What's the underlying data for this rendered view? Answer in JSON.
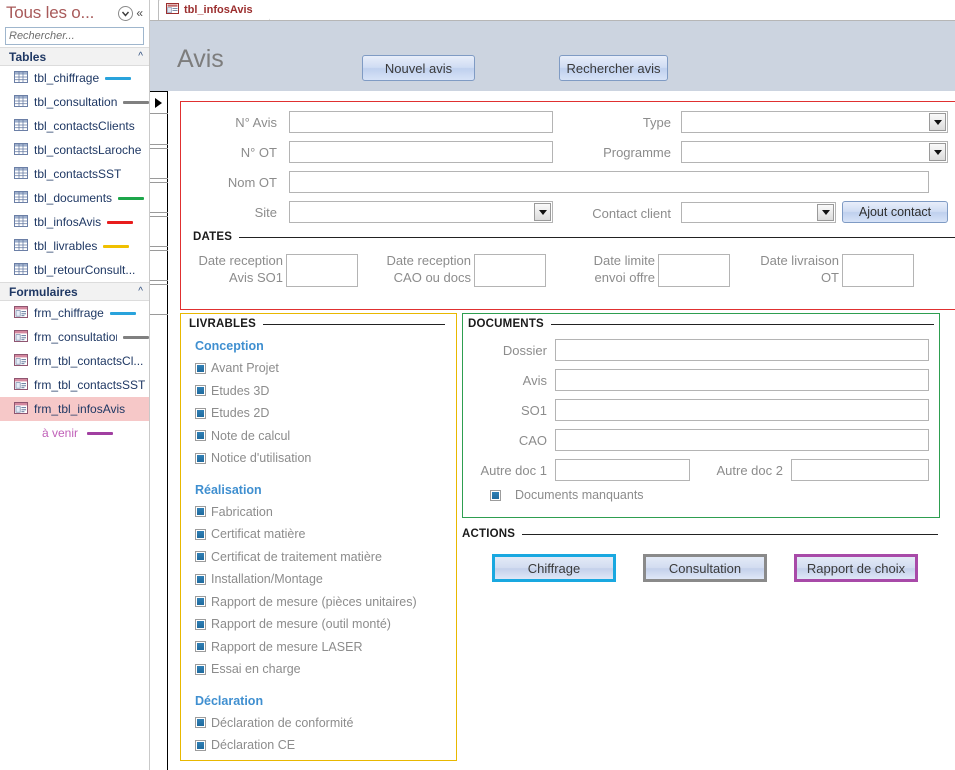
{
  "sidebar": {
    "title": "Tous les o...",
    "dropdown_icon": "chevron-down-circle-icon",
    "collapse_icon": "double-chevron-left-icon",
    "search": {
      "placeholder": "Rechercher...",
      "value": "",
      "icon": "search-icon"
    },
    "groups": [
      {
        "label": "Tables",
        "chevron": "«",
        "items": [
          {
            "label": "tbl_chiffrage",
            "icon": "table-icon",
            "tag_color": "#29a3dc",
            "selected": false
          },
          {
            "label": "tbl_consultation",
            "icon": "table-icon",
            "tag_color": "#808080",
            "selected": false
          },
          {
            "label": "tbl_contactsClients",
            "icon": "table-icon",
            "tag_color": "",
            "selected": false
          },
          {
            "label": "tbl_contactsLaroche",
            "icon": "table-icon",
            "tag_color": "",
            "selected": false
          },
          {
            "label": "tbl_contactsSST",
            "icon": "table-icon",
            "tag_color": "",
            "selected": false
          },
          {
            "label": "tbl_documents",
            "icon": "table-icon",
            "tag_color": "#1da64a",
            "selected": false
          },
          {
            "label": "tbl_infosAvis",
            "icon": "table-icon",
            "tag_color": "#e81c1c",
            "selected": false
          },
          {
            "label": "tbl_livrables",
            "icon": "table-icon",
            "tag_color": "#f0c000",
            "selected": false
          },
          {
            "label": "tbl_retourConsult...",
            "icon": "table-icon",
            "tag_color": "",
            "selected": false
          }
        ]
      },
      {
        "label": "Formulaires",
        "chevron": "«",
        "items": [
          {
            "label": "frm_chiffrage",
            "icon": "form-icon",
            "tag_color": "#29a3dc",
            "selected": false
          },
          {
            "label": "frm_consultation",
            "icon": "form-icon",
            "tag_color": "#808080",
            "selected": false
          },
          {
            "label": "frm_tbl_contactsCl...",
            "icon": "form-icon",
            "tag_color": "",
            "selected": false
          },
          {
            "label": "frm_tbl_contactsSST",
            "icon": "form-icon",
            "tag_color": "",
            "selected": false
          },
          {
            "label": "frm_tbl_infosAvis",
            "icon": "form-icon",
            "tag_color": "",
            "selected": true
          }
        ]
      }
    ],
    "footer_note": {
      "label": "à venir",
      "tag_color": "#a13fa1"
    }
  },
  "document_tab": {
    "label": "tbl_infosAvis",
    "icon": "form-icon"
  },
  "form": {
    "title": "Avis",
    "header_buttons": {
      "new": "Nouvel avis",
      "search": "Rechercher avis"
    },
    "identity": {
      "no_avis": {
        "label": "N° Avis",
        "value": ""
      },
      "no_ot": {
        "label": "N° OT",
        "value": ""
      },
      "nom_ot": {
        "label": "Nom OT",
        "value": ""
      },
      "site": {
        "label": "Site",
        "value": "",
        "type": "combo"
      },
      "type": {
        "label": "Type",
        "value": "",
        "type": "combo"
      },
      "programme": {
        "label": "Programme",
        "value": "",
        "type": "combo"
      },
      "contact_client": {
        "label": "Contact client",
        "value": "",
        "type": "combo"
      },
      "ajout_contact_button": "Ajout contact"
    },
    "dates": {
      "section_label": "DATES",
      "fields": [
        {
          "label_line1": "Date reception",
          "label_line2": "Avis SO1",
          "value": ""
        },
        {
          "label_line1": "Date reception",
          "label_line2": "CAO ou docs",
          "value": ""
        },
        {
          "label_line1": "Date limite",
          "label_line2": "envoi offre",
          "value": ""
        },
        {
          "label_line1": "Date livraison",
          "label_line2": "OT",
          "value": ""
        }
      ]
    },
    "livrables": {
      "section_label": "LIVRABLES",
      "groups": [
        {
          "title": "Conception",
          "items": [
            {
              "label": "Avant Projet",
              "checked": true
            },
            {
              "label": "Etudes 3D",
              "checked": true
            },
            {
              "label": "Etudes 2D",
              "checked": true
            },
            {
              "label": "Note de calcul",
              "checked": true
            },
            {
              "label": "Notice d'utilisation",
              "checked": true
            }
          ]
        },
        {
          "title": "Réalisation",
          "items": [
            {
              "label": "Fabrication",
              "checked": true
            },
            {
              "label": "Certificat matière",
              "checked": true
            },
            {
              "label": "Certificat de traitement matière",
              "checked": true
            },
            {
              "label": "Installation/Montage",
              "checked": true
            },
            {
              "label": "Rapport de mesure (pièces unitaires)",
              "checked": true
            },
            {
              "label": "Rapport de mesure (outil monté)",
              "checked": true
            },
            {
              "label": "Rapport de mesure LASER",
              "checked": true
            },
            {
              "label": "Essai en charge",
              "checked": true
            }
          ]
        },
        {
          "title": "Déclaration",
          "items": [
            {
              "label": "Déclaration de conformité",
              "checked": true
            },
            {
              "label": "Déclaration CE",
              "checked": true
            }
          ]
        }
      ]
    },
    "documents": {
      "section_label": "DOCUMENTS",
      "fields": [
        {
          "label": "Dossier",
          "value": ""
        },
        {
          "label": "Avis",
          "value": ""
        },
        {
          "label": "SO1",
          "value": ""
        },
        {
          "label": "CAO",
          "value": ""
        }
      ],
      "autre_doc_1": {
        "label": "Autre doc 1",
        "value": ""
      },
      "autre_doc_2": {
        "label": "Autre doc 2",
        "value": ""
      },
      "manquants": {
        "label": "Documents manquants",
        "checked": true
      }
    },
    "actions": {
      "section_label": "ACTIONS",
      "buttons": [
        {
          "label": "Chiffrage",
          "border_color": "#19a8e0"
        },
        {
          "label": "Consultation",
          "border_color": "#8a8a8a"
        },
        {
          "label": "Rapport de choix",
          "border_color": "#a84aa8"
        }
      ]
    }
  },
  "colors": {
    "panel_identity_border": "#e03030",
    "panel_livrables_border": "#e8b800",
    "panel_documents_border": "#2e9e50",
    "form_header_bg": "#ccd4e0",
    "selection_bg": "#f6c8c8",
    "sidebar_title": "#a85a5a",
    "subhead": "#3f8fd0"
  }
}
